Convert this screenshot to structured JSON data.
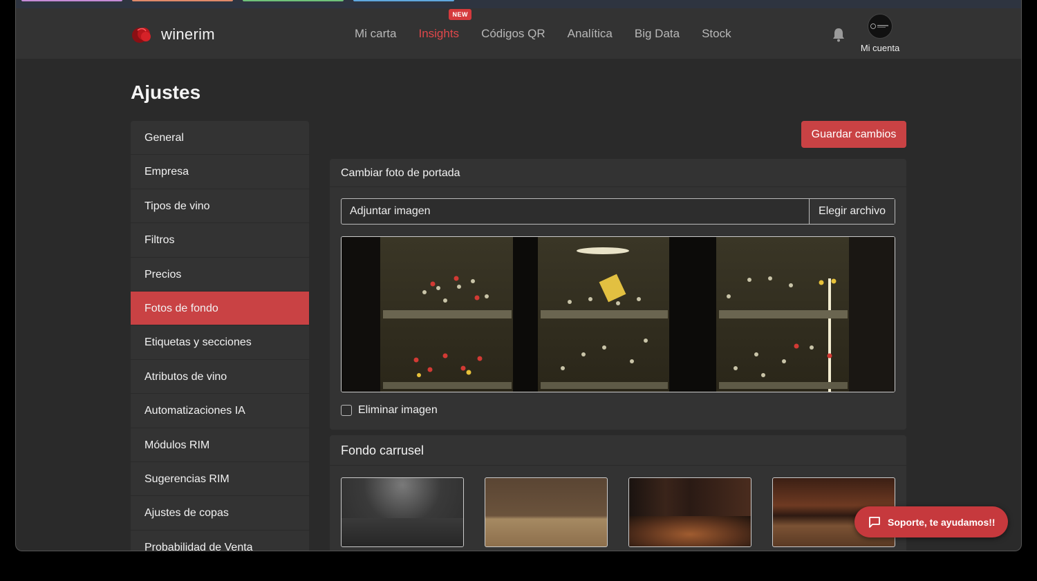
{
  "brand": {
    "name": "winerim"
  },
  "nav": {
    "items": [
      {
        "label": "Mi carta"
      },
      {
        "label": "Insights",
        "badge": "NEW"
      },
      {
        "label": "Códigos QR"
      },
      {
        "label": "Analítica"
      },
      {
        "label": "Big Data"
      },
      {
        "label": "Stock"
      }
    ],
    "active": "Insights",
    "account_label": "Mi cuenta"
  },
  "page": {
    "title": "Ajustes"
  },
  "sidebar": {
    "items": [
      {
        "label": "General"
      },
      {
        "label": "Empresa"
      },
      {
        "label": "Tipos de vino"
      },
      {
        "label": "Filtros"
      },
      {
        "label": "Precios"
      },
      {
        "label": "Fotos de fondo"
      },
      {
        "label": "Etiquetas y secciones"
      },
      {
        "label": "Atributos de vino"
      },
      {
        "label": "Automatizaciones IA"
      },
      {
        "label": "Módulos RIM"
      },
      {
        "label": "Sugerencias RIM"
      },
      {
        "label": "Ajustes de copas"
      },
      {
        "label": "Probabilidad de Venta"
      }
    ],
    "active": "Fotos de fondo"
  },
  "actions": {
    "save_label": "Guardar cambios"
  },
  "cover_card": {
    "title": "Cambiar foto de portada",
    "file_placeholder": "Adjuntar imagen",
    "file_button": "Elegir archivo",
    "remove_label": "Eliminar imagen"
  },
  "carousel_card": {
    "title": "Fondo carrusel"
  },
  "support": {
    "label": "Soporte, te ayudamos!!"
  },
  "colors": {
    "accent": "#c94244",
    "background": "#2a2a2a",
    "panel": "#333333"
  }
}
